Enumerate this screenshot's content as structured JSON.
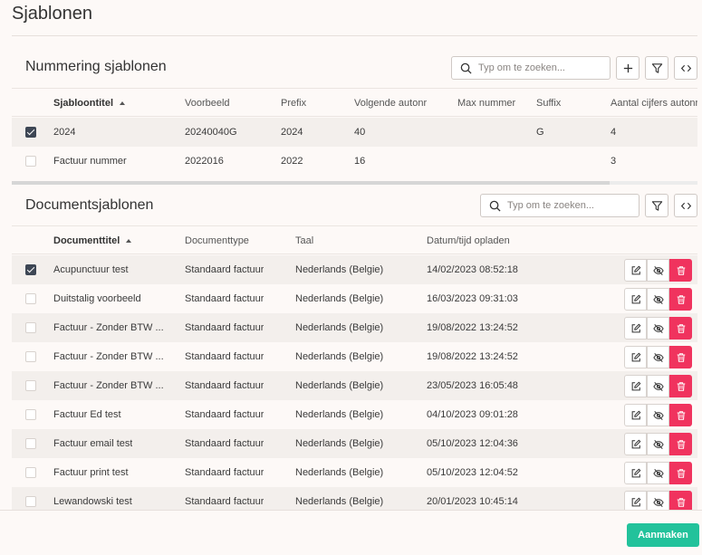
{
  "page": {
    "title": "Sjablonen"
  },
  "numbering": {
    "title": "Nummering sjablonen",
    "search_placeholder": "Typ om te zoeken...",
    "columns": [
      "Sjabloontitel",
      "Voorbeeld",
      "Prefix",
      "Volgende autonr",
      "Max nummer",
      "Suffix",
      "Aantal cijfers autonr"
    ],
    "rows": [
      {
        "checked": true,
        "cells": [
          "2024",
          "20240040G",
          "2024",
          "40",
          "",
          "G",
          "4"
        ]
      },
      {
        "checked": false,
        "cells": [
          "Factuur nummer",
          "2022016",
          "2022",
          "16",
          "",
          "",
          "3"
        ]
      }
    ]
  },
  "documents": {
    "title": "Documentsjablonen",
    "search_placeholder": "Typ om te zoeken...",
    "columns": [
      "Documenttitel",
      "Documenttype",
      "Taal",
      "Datum/tijd opladen"
    ],
    "rows": [
      {
        "checked": true,
        "cells": [
          "Acupunctuur test",
          "Standaard factuur",
          "Nederlands (Belgie)",
          "14/02/2023 08:52:18"
        ]
      },
      {
        "checked": false,
        "cells": [
          "Duitstalig voorbeeld",
          "Standaard factuur",
          "Nederlands (Belgie)",
          "16/03/2023 09:31:03"
        ]
      },
      {
        "checked": false,
        "cells": [
          "Factuur - Zonder BTW ...",
          "Standaard factuur",
          "Nederlands (Belgie)",
          "19/08/2022 13:24:52"
        ]
      },
      {
        "checked": false,
        "cells": [
          "Factuur - Zonder BTW ...",
          "Standaard factuur",
          "Nederlands (Belgie)",
          "19/08/2022 13:24:52"
        ]
      },
      {
        "checked": false,
        "cells": [
          "Factuur - Zonder BTW ...",
          "Standaard factuur",
          "Nederlands (Belgie)",
          "23/05/2023 16:05:48"
        ]
      },
      {
        "checked": false,
        "cells": [
          "Factuur Ed test",
          "Standaard factuur",
          "Nederlands (Belgie)",
          "04/10/2023 09:01:28"
        ]
      },
      {
        "checked": false,
        "cells": [
          "Factuur email test",
          "Standaard factuur",
          "Nederlands (Belgie)",
          "05/10/2023 12:04:36"
        ]
      },
      {
        "checked": false,
        "cells": [
          "Factuur print test",
          "Standaard factuur",
          "Nederlands (Belgie)",
          "05/10/2023 12:04:52"
        ]
      },
      {
        "checked": false,
        "cells": [
          "Lewandowski test",
          "Standaard factuur",
          "Nederlands (Belgie)",
          "20/01/2023 10:45:14"
        ]
      }
    ]
  },
  "footer": {
    "create_label": "Aanmaken"
  },
  "icons": {
    "search": "search-icon",
    "add": "plus-icon",
    "filter": "filter-icon",
    "code": "code-icon",
    "edit": "edit-icon",
    "hide": "eye-off-icon",
    "delete": "trash-icon"
  },
  "colors": {
    "accent": "#22c29b",
    "danger": "#f0335e",
    "checkbox": "#3d4654",
    "background": "#fdf9f7"
  }
}
